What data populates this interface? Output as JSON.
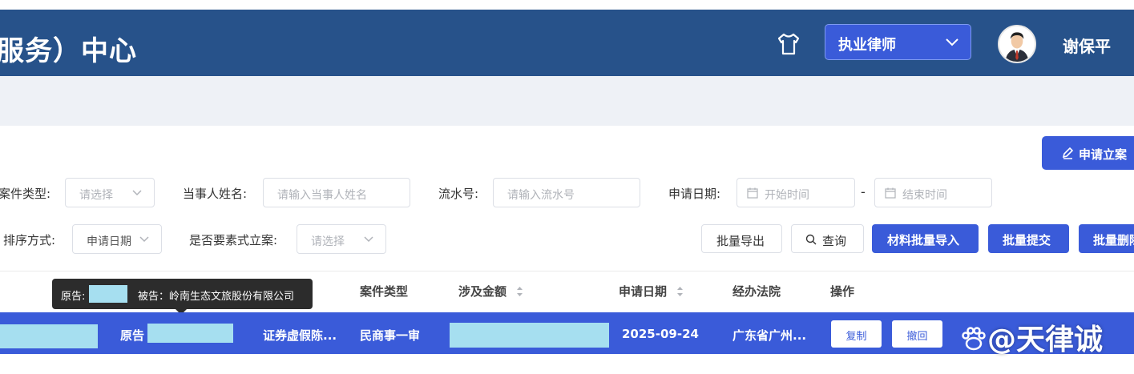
{
  "header": {
    "title": "服务）中心",
    "role": "执业律师",
    "user_name": "谢保平"
  },
  "actions": {
    "apply_label": "申请立案"
  },
  "filters": {
    "case_type": {
      "label": "案件类型:",
      "placeholder": "请选择"
    },
    "party_name": {
      "label": "当事人姓名:",
      "placeholder": "请输入当事人姓名"
    },
    "serial_no": {
      "label": "流水号:",
      "placeholder": "请输入流水号"
    },
    "apply_date": {
      "label": "申请日期:",
      "start_placeholder": "开始时间",
      "separator": "-",
      "end_placeholder": "结束时间"
    },
    "sort": {
      "label": "排序方式:",
      "value": "申请日期"
    },
    "element_filing": {
      "label": "是否要素式立案:",
      "placeholder": "请选择"
    }
  },
  "toolbar": {
    "export_label": "批量导出",
    "query_label": "查询",
    "import_label": "材料批量导入",
    "submit_label": "批量提交",
    "delete_label": "批量删除"
  },
  "table": {
    "headers": {
      "case_type": "案件类型",
      "amount": "涉及金额",
      "apply_date": "申请日期",
      "court": "经办法院",
      "operation": "操作"
    },
    "tooltip": {
      "plaintiff_label": "原告:",
      "defendant_text": "被告：岭南生态文旅股份有限公司"
    },
    "row": {
      "party_prefix": "原告",
      "cause": "证券虚假陈...",
      "case_type": "民商事一审",
      "apply_date": "2025-09-24",
      "court": "广东省广州...",
      "copy_label": "复制",
      "withdraw_label": "撤回"
    }
  },
  "watermark": "@天律诚"
}
